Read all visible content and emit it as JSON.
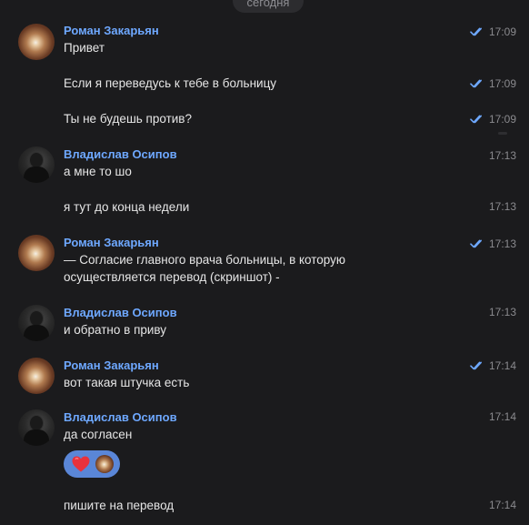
{
  "date_separator": "сегодня",
  "colors": {
    "background": "#1b1b1d",
    "sender": "#6ea8ff",
    "text": "#e6e6e6",
    "time": "#8a8a8e",
    "read_checks": "#6ea8ff",
    "reaction_bg": "#5a86d7"
  },
  "messages": [
    {
      "sender": "Роман Закарьян",
      "text": "Привет",
      "time": "17:09",
      "read": true,
      "avatar": "roman"
    },
    {
      "text": "Если я переведусь к тебе в больницу",
      "time": "17:09",
      "read": true
    },
    {
      "text": "Ты не будешь против?",
      "time": "17:09",
      "read": true
    },
    {
      "sender": "Владислав Осипов",
      "text": "а мне то шо",
      "time": "17:13",
      "read": false,
      "avatar": "vlad"
    },
    {
      "text": "я тут до конца недели",
      "time": "17:13",
      "read": false
    },
    {
      "sender": "Роман Закарьян",
      "text_line1": "— Согласие главного врача больницы, в которую",
      "text_line2": "осуществляется перевод (скриншот) -",
      "time": "17:13",
      "read": true,
      "avatar": "roman"
    },
    {
      "sender": "Владислав Осипов",
      "text": "и обратно в приву",
      "time": "17:13",
      "read": false,
      "avatar": "vlad"
    },
    {
      "sender": "Роман Закарьян",
      "text": "вот такая штучка есть",
      "time": "17:14",
      "read": true,
      "avatar": "roman"
    },
    {
      "sender": "Владислав Осипов",
      "text": "да согласен",
      "time": "17:14",
      "read": false,
      "avatar": "vlad",
      "reaction": "red-heart"
    },
    {
      "text": "пишите на перевод",
      "time": "17:14",
      "read": false
    }
  ]
}
